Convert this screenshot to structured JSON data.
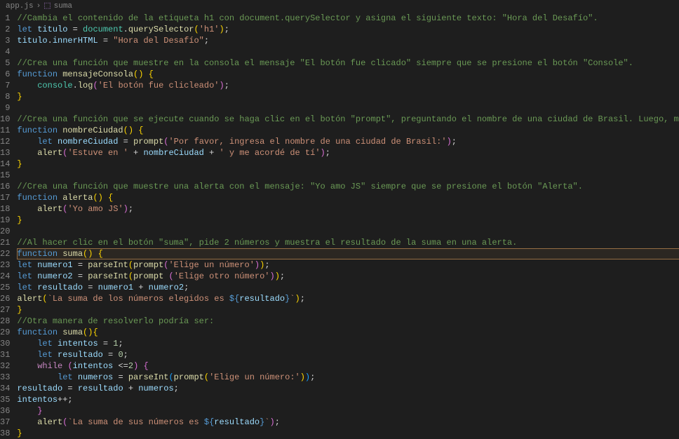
{
  "breadcrumb": {
    "file": "app.js",
    "sep": "›",
    "symbol": "suma"
  },
  "highlight_line": 22,
  "code": {
    "lines": [
      {
        "n": 1,
        "tokens": [
          [
            "comment",
            "//Cambia el contenido de la etiqueta h1 con document.querySelector y asigna el siguiente texto: \"Hora del Desafío\"."
          ]
        ]
      },
      {
        "n": 2,
        "tokens": [
          [
            "kw",
            "let "
          ],
          [
            "var",
            "titulo"
          ],
          [
            "op",
            " = "
          ],
          [
            "obj",
            "document"
          ],
          [
            "op",
            "."
          ],
          [
            "fn",
            "querySelector"
          ],
          [
            "paren",
            "("
          ],
          [
            "str",
            "'h1'"
          ],
          [
            "paren",
            ")"
          ],
          [
            "op",
            ";"
          ]
        ]
      },
      {
        "n": 3,
        "tokens": [
          [
            "var",
            "titulo"
          ],
          [
            "op",
            "."
          ],
          [
            "prop",
            "innerHTML"
          ],
          [
            "op",
            " = "
          ],
          [
            "str",
            "\"Hora del Desafío\""
          ],
          [
            "op",
            ";"
          ]
        ]
      },
      {
        "n": 4,
        "tokens": []
      },
      {
        "n": 5,
        "tokens": [
          [
            "comment",
            "//Crea una función que muestre en la consola el mensaje \"El botón fue clicado\" siempre que se presione el botón \"Console\"."
          ]
        ]
      },
      {
        "n": 6,
        "tokens": [
          [
            "kw",
            "function "
          ],
          [
            "fn",
            "mensajeConsola"
          ],
          [
            "paren",
            "()"
          ],
          [
            "op",
            " "
          ],
          [
            "paren",
            "{"
          ]
        ]
      },
      {
        "n": 7,
        "tokens": [
          [
            "indent",
            "    "
          ],
          [
            "obj",
            "console"
          ],
          [
            "op",
            "."
          ],
          [
            "fn",
            "log"
          ],
          [
            "paren2",
            "("
          ],
          [
            "str",
            "'El botón fue clicleado'"
          ],
          [
            "paren2",
            ")"
          ],
          [
            "op",
            ";"
          ]
        ]
      },
      {
        "n": 8,
        "tokens": [
          [
            "paren",
            "}"
          ]
        ]
      },
      {
        "n": 9,
        "tokens": []
      },
      {
        "n": 10,
        "tokens": [
          [
            "comment",
            "//Crea una función que se ejecute cuando se haga clic en el botón \"prompt\", preguntando el nombre de una ciudad de Brasil. Luego, muestra una al"
          ]
        ]
      },
      {
        "n": 11,
        "tokens": [
          [
            "kw",
            "function "
          ],
          [
            "fn",
            "nombreCiudad"
          ],
          [
            "paren",
            "()"
          ],
          [
            "op",
            " "
          ],
          [
            "paren",
            "{"
          ]
        ]
      },
      {
        "n": 12,
        "tokens": [
          [
            "indent",
            "    "
          ],
          [
            "kw",
            "let "
          ],
          [
            "var",
            "nombreCiudad"
          ],
          [
            "op",
            " = "
          ],
          [
            "fn",
            "prompt"
          ],
          [
            "paren2",
            "("
          ],
          [
            "str",
            "'Por favor, ingresa el nombre de una ciudad de Brasil:'"
          ],
          [
            "paren2",
            ")"
          ],
          [
            "op",
            ";"
          ]
        ]
      },
      {
        "n": 13,
        "tokens": [
          [
            "indent",
            "    "
          ],
          [
            "fn",
            "alert"
          ],
          [
            "paren2",
            "("
          ],
          [
            "str",
            "'Estuve en '"
          ],
          [
            "op",
            " + "
          ],
          [
            "var",
            "nombreCiudad"
          ],
          [
            "op",
            " + "
          ],
          [
            "str",
            "' y me acordé de tí'"
          ],
          [
            "paren2",
            ")"
          ],
          [
            "op",
            ";"
          ]
        ]
      },
      {
        "n": 14,
        "tokens": [
          [
            "paren",
            "}"
          ]
        ]
      },
      {
        "n": 15,
        "tokens": []
      },
      {
        "n": 16,
        "tokens": [
          [
            "comment",
            "//Crea una función que muestre una alerta con el mensaje: \"Yo amo JS\" siempre que se presione el botón \"Alerta\"."
          ]
        ]
      },
      {
        "n": 17,
        "tokens": [
          [
            "kw",
            "function "
          ],
          [
            "fn",
            "alerta"
          ],
          [
            "paren",
            "()"
          ],
          [
            "op",
            " "
          ],
          [
            "paren",
            "{"
          ]
        ]
      },
      {
        "n": 18,
        "tokens": [
          [
            "indent",
            "    "
          ],
          [
            "fn",
            "alert"
          ],
          [
            "paren2",
            "("
          ],
          [
            "str",
            "'Yo amo JS'"
          ],
          [
            "paren2",
            ")"
          ],
          [
            "op",
            ";"
          ]
        ]
      },
      {
        "n": 19,
        "tokens": [
          [
            "paren",
            "}"
          ]
        ]
      },
      {
        "n": 20,
        "tokens": []
      },
      {
        "n": 21,
        "tokens": [
          [
            "comment",
            "//Al hacer clic en el botón \"suma\", pide 2 números y muestra el resultado de la suma en una alerta."
          ]
        ]
      },
      {
        "n": 22,
        "tokens": [
          [
            "kw",
            "function "
          ],
          [
            "fn",
            "suma"
          ],
          [
            "paren",
            "()"
          ],
          [
            "op",
            " "
          ],
          [
            "paren",
            "{"
          ]
        ]
      },
      {
        "n": 23,
        "tokens": [
          [
            "kw",
            "let "
          ],
          [
            "var",
            "numero1"
          ],
          [
            "op",
            " = "
          ],
          [
            "fn",
            "parseInt"
          ],
          [
            "paren",
            "("
          ],
          [
            "fn",
            "prompt"
          ],
          [
            "paren2",
            "("
          ],
          [
            "str",
            "'Elige un número'"
          ],
          [
            "paren2",
            ")"
          ],
          [
            "paren",
            ")"
          ],
          [
            "op",
            ";"
          ]
        ]
      },
      {
        "n": 24,
        "tokens": [
          [
            "kw",
            "let "
          ],
          [
            "var",
            "numero2"
          ],
          [
            "op",
            " = "
          ],
          [
            "fn",
            "parseInt"
          ],
          [
            "paren",
            "("
          ],
          [
            "fn",
            "prompt "
          ],
          [
            "paren2",
            "("
          ],
          [
            "str",
            "'Elige otro número'"
          ],
          [
            "paren2",
            ")"
          ],
          [
            "paren",
            ")"
          ],
          [
            "op",
            ";"
          ]
        ]
      },
      {
        "n": 25,
        "tokens": [
          [
            "kw",
            "let "
          ],
          [
            "var",
            "resultado"
          ],
          [
            "op",
            " = "
          ],
          [
            "var",
            "numero1"
          ],
          [
            "op",
            " + "
          ],
          [
            "var",
            "numero2"
          ],
          [
            "op",
            ";"
          ]
        ]
      },
      {
        "n": 26,
        "tokens": [
          [
            "fn",
            "alert"
          ],
          [
            "paren",
            "("
          ],
          [
            "str",
            "`La suma de los números elegidos es "
          ],
          [
            "kw",
            "${"
          ],
          [
            "var",
            "resultado"
          ],
          [
            "kw",
            "}"
          ],
          [
            "str",
            "`"
          ],
          [
            "paren",
            ")"
          ],
          [
            "op",
            ";"
          ]
        ]
      },
      {
        "n": 27,
        "tokens": [
          [
            "paren",
            "}"
          ]
        ]
      },
      {
        "n": 28,
        "tokens": [
          [
            "comment",
            "//Otra manera de resolverlo podría ser:"
          ]
        ]
      },
      {
        "n": 29,
        "tokens": [
          [
            "kw",
            "function "
          ],
          [
            "fn",
            "suma"
          ],
          [
            "paren",
            "()"
          ],
          [
            "paren",
            "{"
          ]
        ]
      },
      {
        "n": 30,
        "tokens": [
          [
            "indent",
            "    "
          ],
          [
            "kw",
            "let "
          ],
          [
            "var",
            "intentos"
          ],
          [
            "op",
            " = "
          ],
          [
            "num",
            "1"
          ],
          [
            "op",
            ";"
          ]
        ]
      },
      {
        "n": 31,
        "tokens": [
          [
            "indent",
            "    "
          ],
          [
            "kw",
            "let "
          ],
          [
            "var",
            "resultado"
          ],
          [
            "op",
            " = "
          ],
          [
            "num",
            "0"
          ],
          [
            "op",
            ";"
          ]
        ]
      },
      {
        "n": 32,
        "tokens": [
          [
            "indent",
            "    "
          ],
          [
            "kw2",
            "while "
          ],
          [
            "paren2",
            "("
          ],
          [
            "var",
            "intentos"
          ],
          [
            "op",
            " <="
          ],
          [
            "num",
            "2"
          ],
          [
            "paren2",
            ")"
          ],
          [
            "op",
            " "
          ],
          [
            "paren2",
            "{"
          ]
        ]
      },
      {
        "n": 33,
        "tokens": [
          [
            "indent",
            "        "
          ],
          [
            "kw",
            "let "
          ],
          [
            "var",
            "numeros"
          ],
          [
            "op",
            " = "
          ],
          [
            "fn",
            "parseInt"
          ],
          [
            "paren3",
            "("
          ],
          [
            "fn",
            "prompt"
          ],
          [
            "paren",
            "("
          ],
          [
            "str",
            "'Elige un número:'"
          ],
          [
            "paren",
            ")"
          ],
          [
            "paren3",
            ")"
          ],
          [
            "op",
            ";"
          ]
        ]
      },
      {
        "n": 34,
        "tokens": [
          [
            "var",
            "resultado"
          ],
          [
            "op",
            " = "
          ],
          [
            "var",
            "resultado"
          ],
          [
            "op",
            " + "
          ],
          [
            "var",
            "numeros"
          ],
          [
            "op",
            ";"
          ]
        ]
      },
      {
        "n": 35,
        "tokens": [
          [
            "var",
            "intentos"
          ],
          [
            "op",
            "++;"
          ]
        ]
      },
      {
        "n": 36,
        "tokens": [
          [
            "indent",
            "    "
          ],
          [
            "paren2",
            "}"
          ]
        ]
      },
      {
        "n": 37,
        "tokens": [
          [
            "indent",
            "    "
          ],
          [
            "fn",
            "alert"
          ],
          [
            "paren2",
            "("
          ],
          [
            "str",
            "`La suma de sus números es "
          ],
          [
            "kw",
            "${"
          ],
          [
            "var",
            "resultado"
          ],
          [
            "kw",
            "}"
          ],
          [
            "str",
            "`"
          ],
          [
            "paren2",
            ")"
          ],
          [
            "op",
            ";"
          ]
        ]
      },
      {
        "n": 38,
        "tokens": [
          [
            "paren",
            "}"
          ]
        ]
      }
    ]
  }
}
